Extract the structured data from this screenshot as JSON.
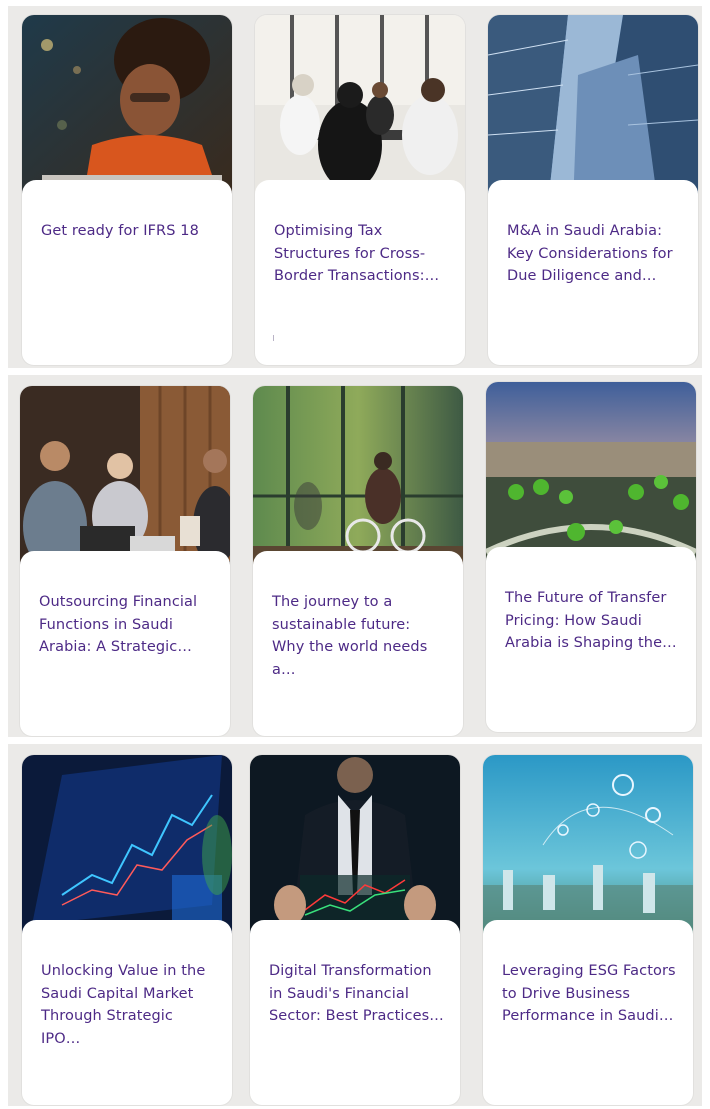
{
  "page": {
    "cards": [
      {
        "title": "Get ready for IFRS 18",
        "image": "woman-laptop-photo"
      },
      {
        "title": "Optimising Tax Structures for Cross-Border Transactions:…",
        "image": "business-meeting-photo"
      },
      {
        "title": "M&A in Saudi Arabia: Key Considerations for Due Diligence and…",
        "image": "skyscrapers-photo"
      },
      {
        "title": "Outsourcing Financial Functions in Saudi Arabia: A Strategic…",
        "image": "team-meeting-photo"
      },
      {
        "title": "The journey to a sustainable future: Why the world needs a…",
        "image": "cyclist-photo"
      },
      {
        "title": "The Future of Transfer Pricing: How Saudi Arabia is Shaping the…",
        "image": "city-aerial-photo"
      },
      {
        "title": "Unlocking Value in the Saudi Capital Market Through Strategic IPO…",
        "image": "stock-chart-photo"
      },
      {
        "title": "Digital Transformation in Saudi's Financial Sector: Best Practices…",
        "image": "businessman-hologram-photo"
      },
      {
        "title": "Leveraging ESG Factors to Drive Business Performance in Saudi…",
        "image": "esg-city-photo"
      }
    ]
  },
  "colors": {
    "title_text": "#4d2a86",
    "background": "#ebeae8",
    "card": "#ffffff"
  }
}
